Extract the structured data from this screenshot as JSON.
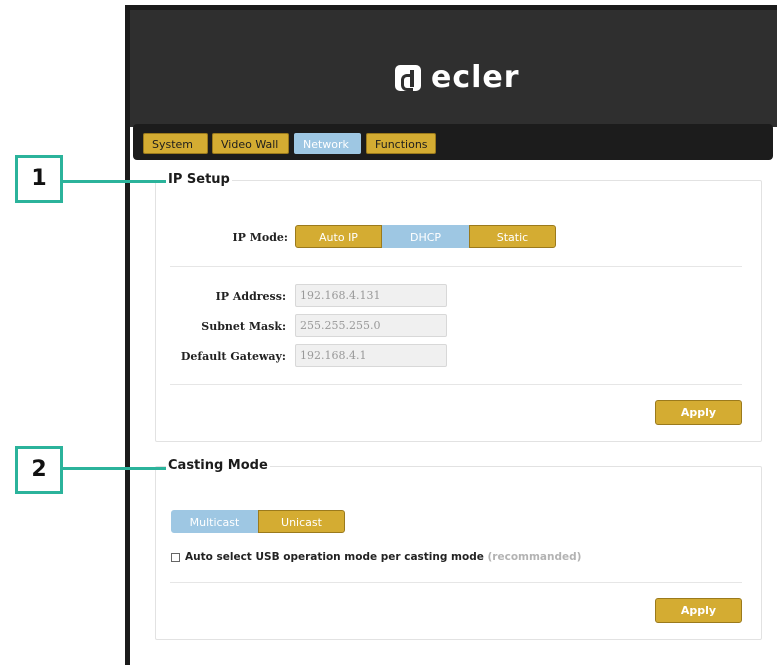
{
  "brand": {
    "logo_text": "ecler"
  },
  "tabs": [
    {
      "label": "System",
      "active": false
    },
    {
      "label": "Video Wall",
      "active": false
    },
    {
      "label": "Network",
      "active": true
    },
    {
      "label": "Functions",
      "active": false
    }
  ],
  "ip_setup": {
    "legend": "IP Setup",
    "mode_label": "IP Mode:",
    "modes": [
      "Auto IP",
      "DHCP",
      "Static"
    ],
    "selected_mode": "DHCP",
    "fields": [
      {
        "label": "IP Address:",
        "value": "192.168.4.131"
      },
      {
        "label": "Subnet Mask:",
        "value": "255.255.255.0"
      },
      {
        "label": "Default Gateway:",
        "value": "192.168.4.1"
      }
    ],
    "apply_label": "Apply"
  },
  "casting_mode": {
    "legend": "Casting Mode",
    "modes": [
      "Multicast",
      "Unicast"
    ],
    "selected_mode": "Multicast",
    "checkbox_label": "Auto select USB operation mode per casting mode",
    "checkbox_hint": "(recommanded)",
    "checkbox_checked": false,
    "apply_label": "Apply"
  },
  "callouts": [
    "1",
    "2"
  ],
  "colors": {
    "accent": "#d4ac32",
    "selected": "#9ec7e3",
    "callout": "#2bb39b",
    "header": "#2f2f2f"
  }
}
